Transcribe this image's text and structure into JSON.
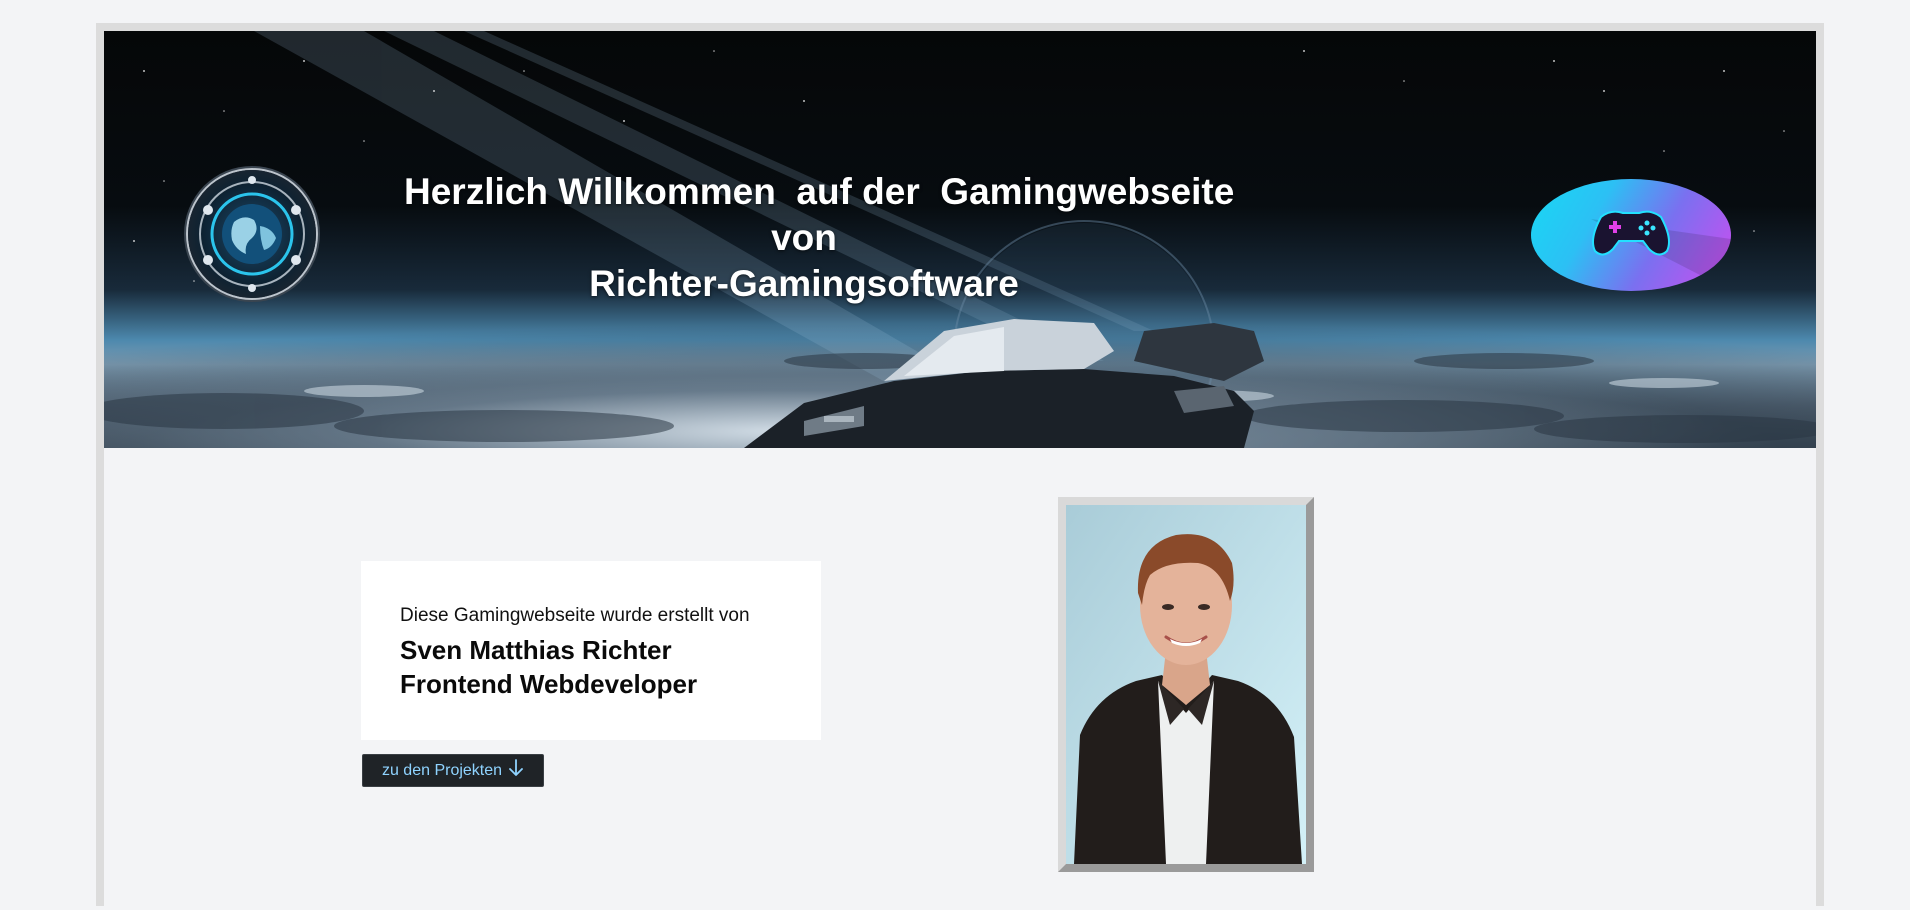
{
  "banner": {
    "welcome_line1": "Herzlich Willkommen  auf der  Gamingwebseite",
    "welcome_line2": "von",
    "welcome_line3": "Richter-Gamingsoftware",
    "logo_left_icon": "globe-tech-icon",
    "logo_right_icon": "gamepad-icon"
  },
  "intro_card": {
    "intro_text": "Diese Gamingwebseite wurde erstellt von",
    "name": "Sven Matthias Richter",
    "role": "Frontend Webdeveloper"
  },
  "projects_button": {
    "label": "zu den Projekten",
    "icon": "arrow-down-icon"
  },
  "profile_photo": {
    "icon": "portrait-photo"
  },
  "colors": {
    "page_background": "#f3f4f6",
    "frame_border": "#dcdcdc",
    "button_background": "#1f2327",
    "button_text": "#8fd3ff"
  }
}
